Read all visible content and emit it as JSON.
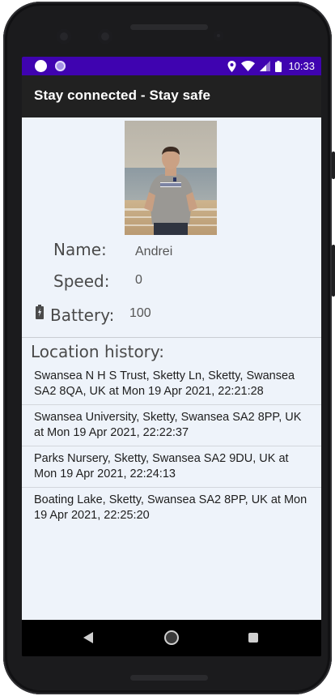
{
  "status_bar": {
    "time": "10:33",
    "icons": [
      "notification-dot-icon",
      "notification-ring-icon",
      "location-icon",
      "wifi-icon",
      "signal-icon",
      "battery-icon"
    ],
    "color": "#3f03b0"
  },
  "app_bar": {
    "title": "Stay connected - Stay safe",
    "color": "#212121"
  },
  "profile": {
    "photo": "user-photo",
    "name_label": "Name:",
    "name_value": "Andrei",
    "speed_label": "Speed:",
    "speed_value": "0",
    "battery_label": "Battery:",
    "battery_value": "100",
    "battery_icon": "battery-full-icon"
  },
  "history": {
    "title": "Location history:",
    "items": [
      "Swansea N H S Trust, Sketty Ln, Sketty, Swansea SA2 8QA, UK at Mon 19 Apr 2021, 22:21:28",
      "Swansea University, Sketty, Swansea SA2 8PP, UK at Mon 19 Apr 2021, 22:22:37",
      "Parks Nursery, Sketty, Swansea SA2 9DU, UK at Mon 19 Apr 2021, 22:24:13",
      "Boating Lake, Sketty, Swansea SA2 8PP, UK at Mon 19 Apr 2021, 22:25:20"
    ]
  },
  "nav_bar": {
    "icons": [
      "back-icon",
      "home-icon",
      "recents-icon"
    ]
  },
  "colors": {
    "content_background": "#eef3fa",
    "label_text": "#4a4a4a"
  }
}
